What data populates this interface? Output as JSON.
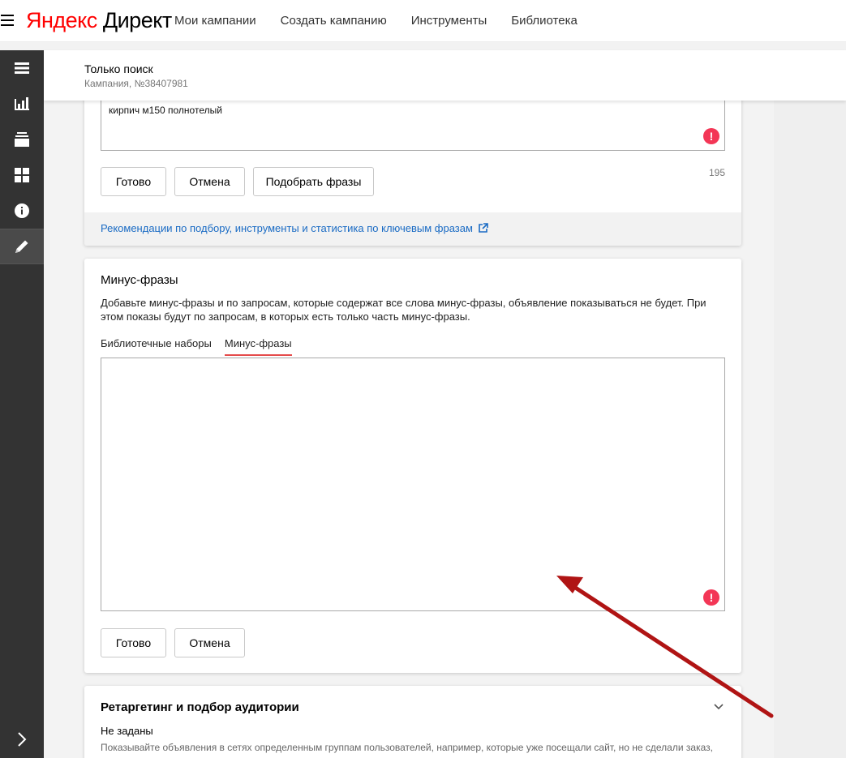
{
  "header": {
    "logo_brand": "Яндекс",
    "logo_product": "Директ",
    "nav": [
      "Мои кампании",
      "Создать кампанию",
      "Инструменты",
      "Библиотека"
    ]
  },
  "campaign": {
    "title": "Только поиск",
    "subtitle": "Кампания, №38407981"
  },
  "keywords_card": {
    "visible_phrase": "кирпич м150 полнотелый",
    "done_label": "Готово",
    "cancel_label": "Отмена",
    "pick_label": "Подобрать фразы",
    "counter": "195",
    "recommendation_link": "Рекомендации по подбору, инструменты и статистика по ключевым фразам"
  },
  "minus_card": {
    "title": "Минус-фразы",
    "description": "Добавьте минус-фразы и по запросам, которые содержат все слова минус-фразы, объявление показываться не будет. При этом показы будут по запросам, в которых есть только часть минус-фразы.",
    "tabs": [
      "Библиотечные наборы",
      "Минус-фразы"
    ],
    "active_tab_index": 1,
    "textarea_value": "",
    "done_label": "Готово",
    "cancel_label": "Отмена"
  },
  "retarget_card": {
    "title": "Ретаргетинг и подбор аудитории",
    "status": "Не заданы",
    "description": "Показывайте объявления в сетях определенным группам пользователей, например, которые уже посещали сайт, но не сделали заказ,"
  },
  "sidebar_icons": [
    "list-icon",
    "chart-icon",
    "stack-icon",
    "grid-icon",
    "info-icon",
    "pencil-icon",
    "chevron-right-icon"
  ],
  "colors": {
    "sidebar_bg": "#333333",
    "link": "#1a6bc4",
    "warning": "#f33656",
    "tab_underline": "#e54b4b",
    "arrow": "#b01414"
  }
}
